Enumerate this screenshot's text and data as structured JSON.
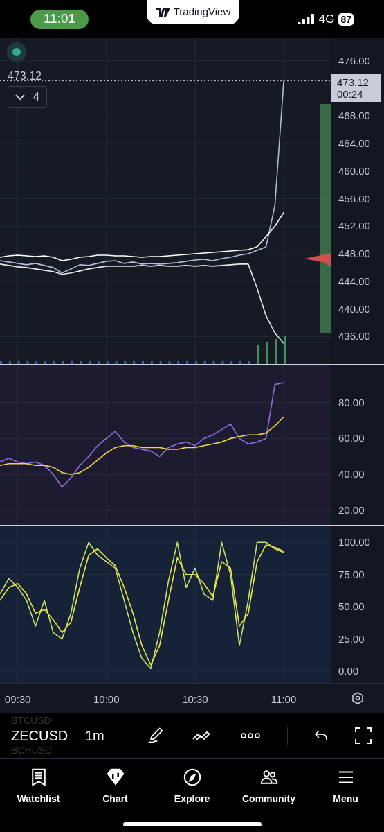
{
  "status_bar": {
    "time": "11:01",
    "network": "4G",
    "battery": "87"
  },
  "app_banner": {
    "title": "TradingView"
  },
  "price_pane": {
    "legend_value": "473.12",
    "indicators_toggle": {
      "count": "4"
    },
    "last_price": {
      "price": "473.12",
      "countdown": "00:24"
    },
    "chart_data": {
      "type": "line",
      "grid": true,
      "ylim": [
        432,
        479.3
      ],
      "ref_lines": [
        {
          "axis": "y",
          "value": 473.1
        }
      ],
      "categories": [
        null,
        null,
        null,
        null,
        null,
        null,
        null,
        null,
        null,
        null,
        null,
        null,
        null,
        null,
        null,
        null,
        null,
        null,
        null,
        null,
        null,
        null,
        null,
        null,
        null,
        null,
        null,
        null,
        null,
        null,
        null,
        null,
        null
      ],
      "yticks": [
        {
          "value": 476,
          "label": "476.00"
        },
        {
          "value": 468,
          "label": "468.00"
        },
        {
          "value": 464,
          "label": "464.00"
        },
        {
          "value": 460,
          "label": "460.00"
        },
        {
          "value": 456,
          "label": "456.00"
        },
        {
          "value": 452,
          "label": "452.00"
        },
        {
          "value": 448,
          "label": "448.00"
        },
        {
          "value": 444,
          "label": "444.00"
        },
        {
          "value": 440,
          "label": "440.00"
        },
        {
          "value": 436,
          "label": "436.00"
        }
      ],
      "series": [
        {
          "color": "#b4bcd0",
          "values": [
            447,
            446.8,
            446.6,
            446.4,
            446.6,
            446.3,
            446,
            445.2,
            445.8,
            446.4,
            446.3,
            446.6,
            446.9,
            447,
            446.6,
            446.8,
            446.5,
            446.6,
            446.5,
            446.6,
            446.7,
            446.9,
            447.1,
            447.2,
            447,
            447.3,
            447.5,
            447.8,
            448,
            448.5,
            449,
            455,
            473.1
          ]
        },
        {
          "color": "#ffffff",
          "values": [
            447.5,
            447.7,
            447.8,
            447.7,
            447.6,
            447.7,
            447.5,
            447,
            447.2,
            447.5,
            447.6,
            447.8,
            447.8,
            447.7,
            447.7,
            447.6,
            447.5,
            447.6,
            447.6,
            447.7,
            447.8,
            447.9,
            448,
            448.1,
            448.2,
            448.3,
            448.4,
            448.5,
            448.6,
            449,
            450.5,
            452,
            454
          ]
        },
        {
          "color": "#e8e8e8",
          "values": [
            446.5,
            446.3,
            446.1,
            446,
            445.8,
            445.6,
            445.4,
            445,
            445.2,
            445.5,
            445.8,
            446,
            446.2,
            446.2,
            446.2,
            446.2,
            446.3,
            446.2,
            446.3,
            446.2,
            446.2,
            446.3,
            446.2,
            446.3,
            446.2,
            446.3,
            446.4,
            446.5,
            446.5,
            443,
            439,
            436.5,
            435
          ]
        }
      ]
    }
  },
  "rsi_pane": {
    "chart_data": {
      "type": "line",
      "grid": true,
      "ylim": [
        12,
        101
      ],
      "categories": [
        null,
        null,
        null,
        null,
        null,
        null,
        null,
        null,
        null,
        null,
        null,
        null,
        null,
        null,
        null,
        null,
        null,
        null,
        null,
        null,
        null,
        null,
        null,
        null,
        null,
        null,
        null,
        null,
        null,
        null,
        null,
        null,
        null
      ],
      "yticks": [
        {
          "value": 80,
          "label": "80.00"
        },
        {
          "value": 60,
          "label": "60.00"
        },
        {
          "value": 40,
          "label": "40.00"
        },
        {
          "value": 20,
          "label": "20.00"
        }
      ],
      "series": [
        {
          "color": "#8f6fe0",
          "values": [
            47,
            49,
            47,
            46,
            47,
            45,
            40,
            33,
            38,
            45,
            50,
            56,
            60,
            64,
            58,
            55,
            54,
            53,
            50,
            55,
            57,
            58,
            56,
            60,
            62,
            65,
            68,
            60,
            57,
            58,
            60,
            90,
            91
          ]
        },
        {
          "color": "#f5d547",
          "values": [
            45,
            46,
            46,
            46,
            45,
            45,
            44,
            41,
            40,
            41,
            44,
            48,
            52,
            55,
            56,
            56,
            55,
            55,
            55,
            54,
            54,
            55,
            55,
            56,
            57,
            58,
            60,
            61,
            62,
            62,
            63,
            67,
            72
          ]
        }
      ]
    }
  },
  "stoch_pane": {
    "chart_data": {
      "type": "line",
      "grid": true,
      "ylim": [
        -9,
        113
      ],
      "categories": [
        null,
        null,
        "09:30",
        null,
        null,
        null,
        null,
        null,
        null,
        null,
        null,
        null,
        "10:00",
        null,
        null,
        null,
        null,
        null,
        null,
        null,
        null,
        null,
        "10:30",
        null,
        null,
        null,
        null,
        null,
        null,
        null,
        null,
        null,
        "11:00"
      ],
      "yticks": [
        {
          "value": 100,
          "label": "100.00"
        },
        {
          "value": 75,
          "label": "75.00"
        },
        {
          "value": 50,
          "label": "50.00"
        },
        {
          "value": 25,
          "label": "25.00"
        },
        {
          "value": 0,
          "label": "0.00"
        }
      ],
      "series": [
        {
          "color": "#c9e36a",
          "values": [
            60,
            72,
            65,
            55,
            35,
            55,
            30,
            25,
            45,
            80,
            100,
            90,
            85,
            80,
            55,
            30,
            10,
            2,
            30,
            70,
            100,
            65,
            80,
            60,
            55,
            100,
            75,
            20,
            55,
            100,
            100,
            95,
            92
          ]
        },
        {
          "color": "#f2e93a",
          "values": [
            55,
            65,
            68,
            60,
            45,
            48,
            40,
            30,
            38,
            65,
            90,
            95,
            88,
            82,
            65,
            45,
            20,
            5,
            20,
            55,
            88,
            75,
            75,
            68,
            58,
            85,
            80,
            35,
            45,
            85,
            98,
            96,
            93
          ]
        }
      ]
    }
  },
  "toolbar": {
    "symbol": "ZECUSD",
    "previous_symbol": "BTCUSD",
    "next_symbol": "BCHUSD",
    "interval": "1m"
  },
  "tab_bar": [
    {
      "label": "Watchlist"
    },
    {
      "label": "Chart"
    },
    {
      "label": "Explore"
    },
    {
      "label": "Community"
    },
    {
      "label": "Menu"
    }
  ]
}
